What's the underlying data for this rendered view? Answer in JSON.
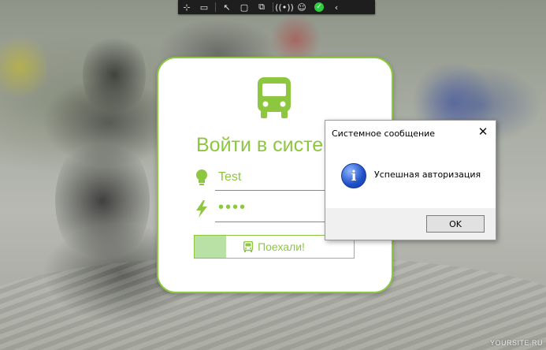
{
  "colors": {
    "accent": "#8dc63f",
    "accent_light": "#b9e0a5",
    "dialog_footer": "#f0f0f0"
  },
  "toolbar": {
    "icons": [
      "cursor-plus-icon",
      "camera-icon",
      "pointer-icon",
      "square-icon",
      "screen-capture-icon",
      "wireless-icon",
      "accessibility-icon",
      "check-icon",
      "chevron-left-icon"
    ]
  },
  "login": {
    "title": "Войти в систему",
    "login_value": "Test",
    "password_mask": "••••",
    "submit_label": "Поехали!",
    "icons": {
      "logo": "bus-icon",
      "login": "lightbulb-icon",
      "password": "lightning-icon",
      "submit": "bus-icon"
    }
  },
  "dialog": {
    "title": "Системное сообщение",
    "close_symbol": "✕",
    "icon": "info-icon",
    "icon_glyph": "i",
    "message": "Успешная авторизация",
    "ok_label": "OK"
  },
  "watermark": "YOURSITE.RU"
}
